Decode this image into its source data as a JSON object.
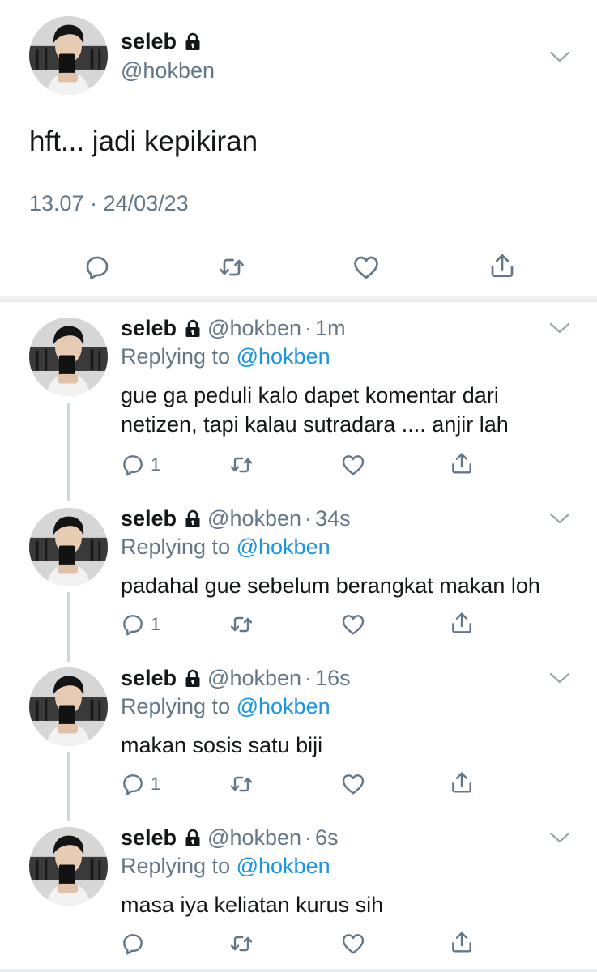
{
  "main_tweet": {
    "name": "seleb",
    "handle": "@hokben",
    "text": "hft... jadi kepikiran",
    "timestamp": "13.07 · 24/03/23",
    "icons": [
      "reply-icon",
      "retweet-icon",
      "like-icon",
      "share-icon"
    ]
  },
  "replies": [
    {
      "name": "seleb",
      "handle": "@hokben",
      "time": "1m",
      "replying_prefix": "Replying to",
      "replying_to": "@hokben",
      "text": "gue ga peduli kalo dapet komentar dari netizen, tapi kalau sutradara .... anjir lah",
      "reply_count": "1"
    },
    {
      "name": "seleb",
      "handle": "@hokben",
      "time": "34s",
      "replying_prefix": "Replying to",
      "replying_to": "@hokben",
      "text": "padahal gue sebelum berangkat makan loh",
      "reply_count": "1"
    },
    {
      "name": "seleb",
      "handle": "@hokben",
      "time": "16s",
      "replying_prefix": "Replying to",
      "replying_to": "@hokben",
      "text": "makan sosis satu biji",
      "reply_count": "1"
    },
    {
      "name": "seleb",
      "handle": "@hokben",
      "time": "6s",
      "replying_prefix": "Replying to",
      "replying_to": "@hokben",
      "text": "masa iya keliatan kurus sih",
      "reply_count": ""
    }
  ],
  "colors": {
    "text": "#14171a",
    "secondary": "#657786",
    "link": "#1b95e0",
    "icon": "#657786"
  }
}
